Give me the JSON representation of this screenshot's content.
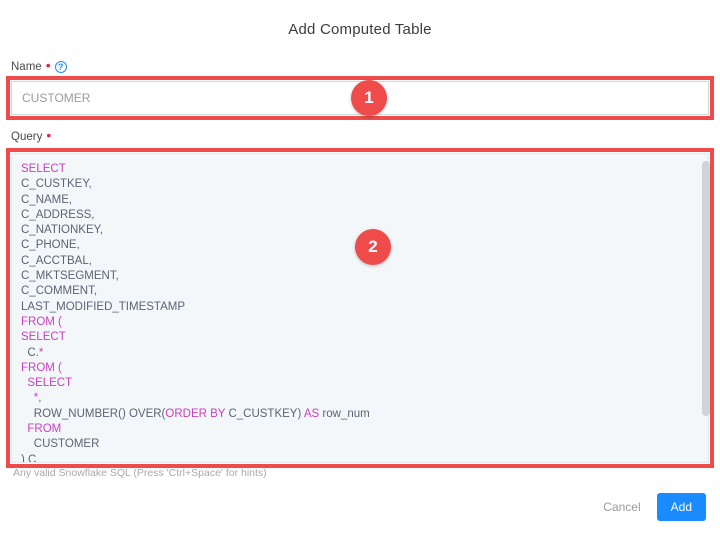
{
  "dialog": {
    "title": "Add Computed Table"
  },
  "fields": {
    "name": {
      "label": "Name",
      "required_marker": "•",
      "help_icon_glyph": "?",
      "value": "CUSTOMER",
      "placeholder": "CUSTOMER"
    },
    "query": {
      "label": "Query",
      "required_marker": "•",
      "hint": "Any valid Snowflake SQL (Press 'Ctrl+Space' for hints)"
    }
  },
  "query_code": {
    "language": "sql",
    "lines": [
      [
        {
          "t": "SELECT",
          "k": true
        }
      ],
      [
        {
          "t": "C_CUSTKEY,",
          "k": false
        }
      ],
      [
        {
          "t": "C_NAME,",
          "k": false
        }
      ],
      [
        {
          "t": "C_ADDRESS,",
          "k": false
        }
      ],
      [
        {
          "t": "C_NATIONKEY,",
          "k": false
        }
      ],
      [
        {
          "t": "C_PHONE,",
          "k": false
        }
      ],
      [
        {
          "t": "C_ACCTBAL,",
          "k": false
        }
      ],
      [
        {
          "t": "C_MKTSEGMENT,",
          "k": false
        }
      ],
      [
        {
          "t": "C_COMMENT,",
          "k": false
        }
      ],
      [
        {
          "t": "LAST_MODIFIED_TIMESTAMP",
          "k": false
        }
      ],
      [
        {
          "t": "FROM (",
          "k": true
        }
      ],
      [
        {
          "t": "SELECT",
          "k": true
        }
      ],
      [
        {
          "t": "  C.",
          "k": false
        },
        {
          "t": "*",
          "k": true
        }
      ],
      [
        {
          "t": "FROM (",
          "k": true
        }
      ],
      [
        {
          "t": "  SELECT",
          "k": true
        }
      ],
      [
        {
          "t": "    ",
          "k": false
        },
        {
          "t": "*",
          "k": true
        },
        {
          "t": ",",
          "k": false
        }
      ],
      [
        {
          "t": "    ROW_NUMBER() OVER(",
          "k": false
        },
        {
          "t": "ORDER BY",
          "k": true
        },
        {
          "t": " C_CUSTKEY) ",
          "k": false
        },
        {
          "t": "AS",
          "k": true
        },
        {
          "t": " row_num",
          "k": false
        }
      ],
      [
        {
          "t": "  FROM",
          "k": true
        }
      ],
      [
        {
          "t": "    CUSTOMER",
          "k": false
        }
      ],
      [
        {
          "t": ") C",
          "k": false
        }
      ]
    ]
  },
  "annotations": [
    {
      "number": "1",
      "target": "name-input"
    },
    {
      "number": "2",
      "target": "query-editor"
    }
  ],
  "footer": {
    "cancel_label": "Cancel",
    "add_label": "Add"
  },
  "colors": {
    "annotation_red": "#ef4b4b",
    "primary_blue": "#1a8cff",
    "sql_keyword": "#c93fc0",
    "editor_background": "#f4f7fa",
    "required_red": "#e8264c"
  }
}
